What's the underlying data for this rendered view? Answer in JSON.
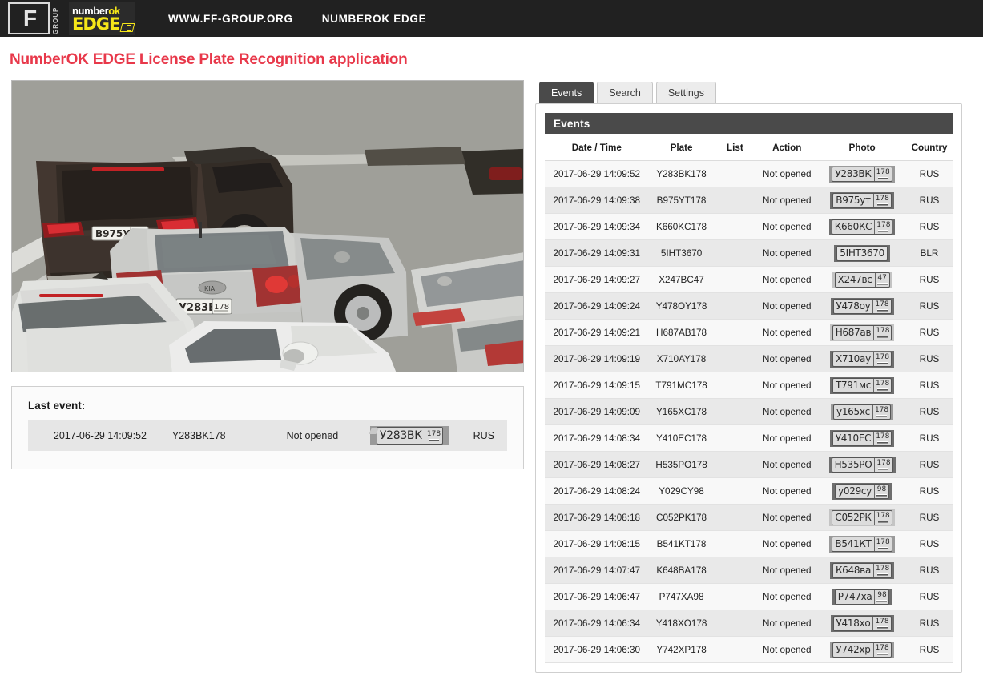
{
  "topbar": {
    "logo_ff_letter": "F",
    "logo_ff_group": "GROUP",
    "logo_number": "number",
    "logo_ok": "ok",
    "logo_edge": "EDGE",
    "nav": [
      {
        "label": "WWW.FF-GROUP.ORG"
      },
      {
        "label": "NUMBEROK EDGE"
      }
    ],
    "background": "#212121"
  },
  "page": {
    "title": "NumberOK EDGE License Plate Recognition application",
    "title_color": "#e8384a"
  },
  "camera": {
    "plates_in_scene": [
      {
        "text": "В975УТ",
        "region": "178"
      },
      {
        "text": "У283ВК",
        "region": "178"
      }
    ]
  },
  "last_event": {
    "title": "Last event:",
    "datetime": "2017-06-29 14:09:52",
    "plate": "Y283BK178",
    "list": "",
    "action": "Not opened",
    "photo_text": "У283ВК",
    "photo_region": "178",
    "country": "RUS"
  },
  "tabs": [
    {
      "label": "Events",
      "active": true
    },
    {
      "label": "Search",
      "active": false
    },
    {
      "label": "Settings",
      "active": false
    }
  ],
  "events_panel": {
    "header": "Events",
    "header_bg": "#4a4a4a",
    "columns": [
      "Date / Time",
      "Plate",
      "List",
      "Action",
      "Photo",
      "Country"
    ],
    "rows": [
      {
        "datetime": "2017-06-29 14:09:52",
        "plate": "Y283BK178",
        "list": "",
        "action": "Not opened",
        "photo_text": "У283ВК",
        "photo_region": "178",
        "photo_bg": "plate-bg-mid",
        "country": "RUS"
      },
      {
        "datetime": "2017-06-29 14:09:38",
        "plate": "B975YT178",
        "list": "",
        "action": "Not opened",
        "photo_text": "В975ут",
        "photo_region": "178",
        "photo_bg": "plate-bg-dark",
        "country": "RUS"
      },
      {
        "datetime": "2017-06-29 14:09:34",
        "plate": "K660KC178",
        "list": "",
        "action": "Not opened",
        "photo_text": "К660КС",
        "photo_region": "178",
        "photo_bg": "plate-bg-dark",
        "country": "RUS"
      },
      {
        "datetime": "2017-06-29 14:09:31",
        "plate": "5IHT3670",
        "list": "",
        "action": "Not opened",
        "photo_text": "5ІНТ3670",
        "photo_region": "",
        "photo_bg": "plate-bg-dark",
        "country": "BLR"
      },
      {
        "datetime": "2017-06-29 14:09:27",
        "plate": "X247BC47",
        "list": "",
        "action": "Not opened",
        "photo_text": "Х247вс",
        "photo_region": "47",
        "photo_bg": "plate-bg-light",
        "country": "RUS"
      },
      {
        "datetime": "2017-06-29 14:09:24",
        "plate": "Y478OY178",
        "list": "",
        "action": "Not opened",
        "photo_text": "У478оу",
        "photo_region": "178",
        "photo_bg": "plate-bg-dark",
        "country": "RUS"
      },
      {
        "datetime": "2017-06-29 14:09:21",
        "plate": "H687AB178",
        "list": "",
        "action": "Not opened",
        "photo_text": "Н687ав",
        "photo_region": "178",
        "photo_bg": "plate-bg-light",
        "country": "RUS"
      },
      {
        "datetime": "2017-06-29 14:09:19",
        "plate": "X710AY178",
        "list": "",
        "action": "Not opened",
        "photo_text": "Х710ау",
        "photo_region": "178",
        "photo_bg": "plate-bg-dark",
        "country": "RUS"
      },
      {
        "datetime": "2017-06-29 14:09:15",
        "plate": "T791MC178",
        "list": "",
        "action": "Not opened",
        "photo_text": "Т791мс",
        "photo_region": "178",
        "photo_bg": "plate-bg-dark",
        "country": "RUS"
      },
      {
        "datetime": "2017-06-29 14:09:09",
        "plate": "Y165XC178",
        "list": "",
        "action": "Not opened",
        "photo_text": "у165хс",
        "photo_region": "178",
        "photo_bg": "plate-bg-mid",
        "country": "RUS"
      },
      {
        "datetime": "2017-06-29 14:08:34",
        "plate": "Y410EC178",
        "list": "",
        "action": "Not opened",
        "photo_text": "У410ЕС",
        "photo_region": "178",
        "photo_bg": "plate-bg-dark",
        "country": "RUS"
      },
      {
        "datetime": "2017-06-29 14:08:27",
        "plate": "H535PO178",
        "list": "",
        "action": "Not opened",
        "photo_text": "Н535РО",
        "photo_region": "178",
        "photo_bg": "plate-bg-dark",
        "country": "RUS"
      },
      {
        "datetime": "2017-06-29 14:08:24",
        "plate": "Y029CY98",
        "list": "",
        "action": "Not opened",
        "photo_text": "у029су",
        "photo_region": "98",
        "photo_bg": "plate-bg-dark",
        "country": "RUS"
      },
      {
        "datetime": "2017-06-29 14:08:18",
        "plate": "C052PK178",
        "list": "",
        "action": "Not opened",
        "photo_text": "С052РК",
        "photo_region": "178",
        "photo_bg": "plate-bg-light",
        "country": "RUS"
      },
      {
        "datetime": "2017-06-29 14:08:15",
        "plate": "B541KT178",
        "list": "",
        "action": "Not opened",
        "photo_text": "В541КТ",
        "photo_region": "178",
        "photo_bg": "plate-bg-mid",
        "country": "RUS"
      },
      {
        "datetime": "2017-06-29 14:07:47",
        "plate": "K648BA178",
        "list": "",
        "action": "Not opened",
        "photo_text": "К648ва",
        "photo_region": "178",
        "photo_bg": "plate-bg-dark",
        "country": "RUS"
      },
      {
        "datetime": "2017-06-29 14:06:47",
        "plate": "P747XA98",
        "list": "",
        "action": "Not opened",
        "photo_text": "Р747ха",
        "photo_region": "98",
        "photo_bg": "plate-bg-dark",
        "country": "RUS"
      },
      {
        "datetime": "2017-06-29 14:06:34",
        "plate": "Y418XO178",
        "list": "",
        "action": "Not opened",
        "photo_text": "У418хо",
        "photo_region": "178",
        "photo_bg": "plate-bg-dark",
        "country": "RUS"
      },
      {
        "datetime": "2017-06-29 14:06:30",
        "plate": "Y742XP178",
        "list": "",
        "action": "Not opened",
        "photo_text": "У742хр",
        "photo_region": "178",
        "photo_bg": "plate-bg-mid",
        "country": "RUS"
      }
    ]
  }
}
